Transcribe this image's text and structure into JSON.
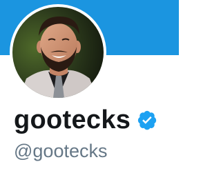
{
  "profile": {
    "display_name": "gootecks",
    "handle": "@gootecks",
    "verified": true,
    "avatar_icon": "profile-photo"
  },
  "colors": {
    "banner": "#1b95e0",
    "verified_badge": "#1da1f2",
    "name_text": "#14171a",
    "handle_text": "#657786"
  }
}
